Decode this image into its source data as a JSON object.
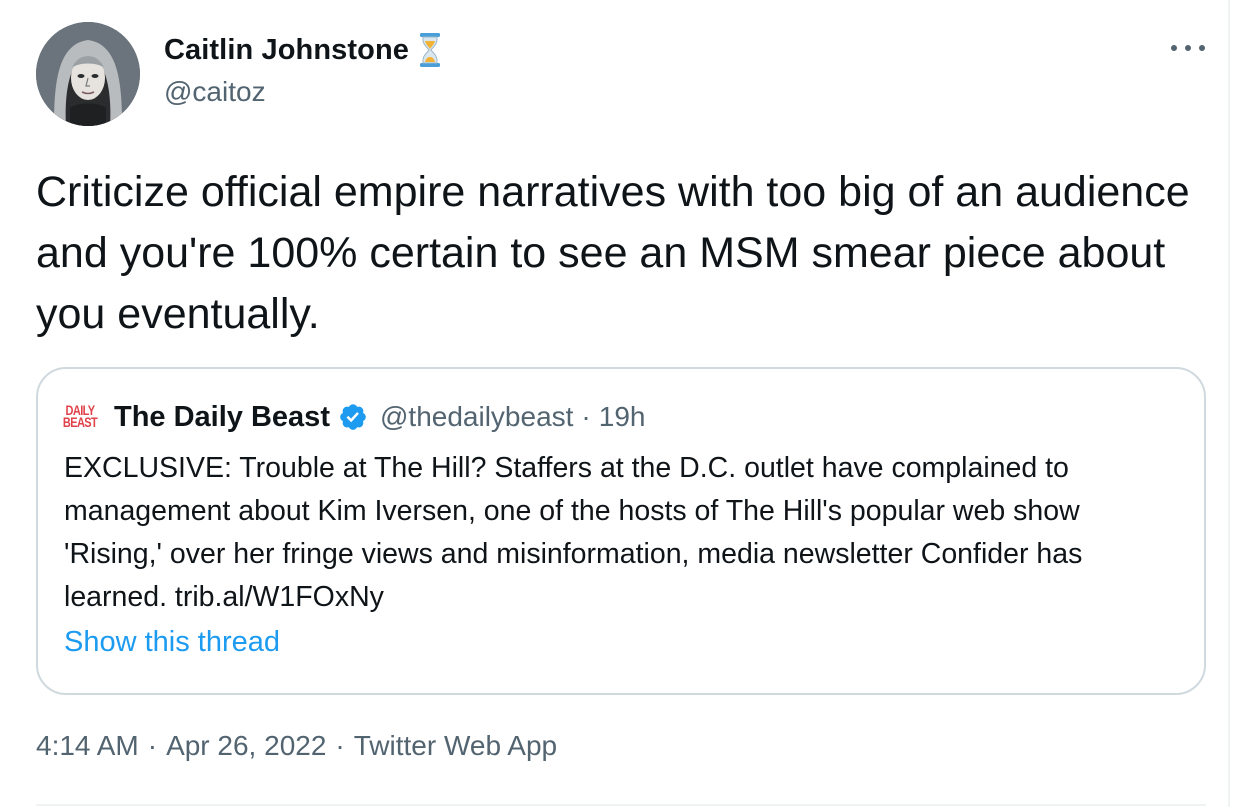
{
  "author": {
    "display_name": "Caitlin Johnstone",
    "handle": "@caitoz",
    "emoji_icon": "hourglass-icon"
  },
  "tweet": {
    "text": "Criticize official empire narratives with too big of an audience and you're 100% certain to see an MSM smear piece about you eventually."
  },
  "quoted_tweet": {
    "logo_lines": [
      "DAILY",
      "BEAST"
    ],
    "display_name": "The Daily Beast",
    "verified_icon": "verified-badge-icon",
    "handle": "@thedailybeast",
    "separator": "·",
    "time": "19h",
    "text": "EXCLUSIVE: Trouble at The Hill? Staffers at the D.C. outlet have complained to management about Kim Iversen, one of the hosts of The Hill's popular web show 'Rising,' over her fringe views and misinformation, media newsletter Confider has learned. trib.al/W1FOxNy",
    "show_thread": "Show this thread"
  },
  "meta": {
    "time": "4:14 AM",
    "separator": "·",
    "date": "Apr 26, 2022",
    "app": "Twitter Web App"
  },
  "colors": {
    "text": "#0f1419",
    "secondary": "#536471",
    "link": "#1d9bf0",
    "border": "#cfd9de",
    "logo_red": "#e0424a"
  }
}
